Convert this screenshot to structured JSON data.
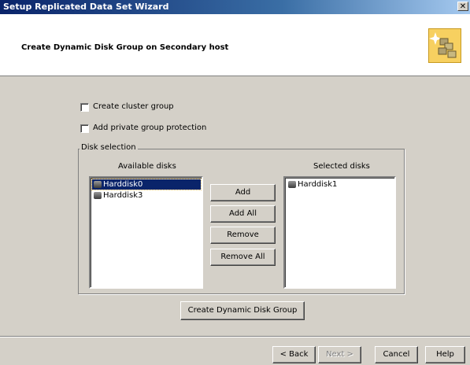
{
  "window": {
    "title": "Setup Replicated Data Set Wizard",
    "close_glyph": "✕"
  },
  "header": {
    "heading": "Create Dynamic Disk Group on Secondary host",
    "icon": "wizard-disk-stack-icon"
  },
  "options": {
    "create_cluster_group": {
      "label": "Create cluster group",
      "checked": false
    },
    "add_private_protection": {
      "label": "Add private group protection",
      "checked": false
    }
  },
  "disk_selection": {
    "group_label": "Disk selection",
    "available_label": "Available disks",
    "selected_label": "Selected disks",
    "available_disks": [
      {
        "name": "Harddisk0",
        "selected": true
      },
      {
        "name": "Harddisk3",
        "selected": false
      }
    ],
    "selected_disks": [
      {
        "name": "Harddisk1",
        "selected": false
      }
    ],
    "buttons": {
      "add": "Add",
      "add_all": "Add All",
      "remove": "Remove",
      "remove_all": "Remove All"
    }
  },
  "create_button": "Create Dynamic Disk Group",
  "footer": {
    "back": "< Back",
    "next": "Next >",
    "cancel": "Cancel",
    "help": "Help"
  },
  "colors": {
    "title_bar": "#0a246a",
    "dialog_bg": "#d4d0c8",
    "selection": "#0a246a"
  }
}
